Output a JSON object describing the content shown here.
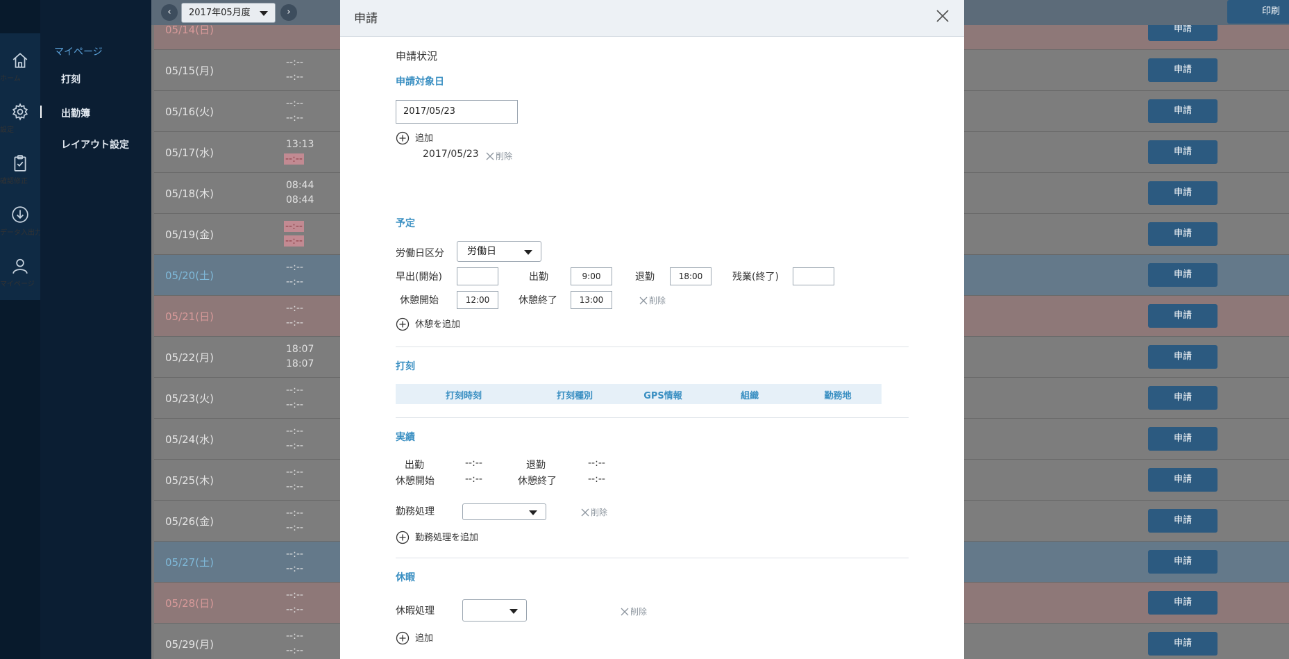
{
  "rail": [
    {
      "label": "ホーム",
      "icon": "home-icon"
    },
    {
      "label": "設定",
      "icon": "gear-icon"
    },
    {
      "label": "確認修正",
      "icon": "clipboard-check-icon"
    },
    {
      "label": "データ入出力",
      "icon": "download-icon"
    },
    {
      "label": "マイページ",
      "icon": "person-icon"
    }
  ],
  "menu": {
    "heading": "マイページ",
    "items": [
      "打刻",
      "出勤簿",
      "レイアウト設定"
    ]
  },
  "topbar": {
    "prev": "‹",
    "next": "›",
    "period": "2017年05月度",
    "print": "印刷"
  },
  "rows": [
    {
      "date": "05/14(日)",
      "t1": "--:--",
      "t2": "",
      "kind": "sun",
      "apply": "申請"
    },
    {
      "date": "05/15(月)",
      "t1": "--:--",
      "t2": "--:--",
      "kind": "",
      "apply": "申請"
    },
    {
      "date": "05/16(火)",
      "t1": "--:--",
      "t2": "--:--",
      "kind": "",
      "apply": "申請"
    },
    {
      "date": "05/17(水)",
      "t1": "13:13",
      "t2": "--:--",
      "kind": "",
      "apply": "申請"
    },
    {
      "date": "05/18(木)",
      "t1": "08:44",
      "t2": "08:44",
      "kind": "",
      "apply": "申請"
    },
    {
      "date": "05/19(金)",
      "t1": "--:--",
      "t2": "--:--",
      "kind": "",
      "apply": "申請"
    },
    {
      "date": "05/20(土)",
      "t1": "--:--",
      "t2": "--:--",
      "kind": "sat",
      "apply": "申請"
    },
    {
      "date": "05/21(日)",
      "t1": "--:--",
      "t2": "--:--",
      "kind": "sun",
      "apply": "申請"
    },
    {
      "date": "05/22(月)",
      "t1": "18:07",
      "t2": "18:07",
      "kind": "",
      "apply": "申請"
    },
    {
      "date": "05/23(火)",
      "t1": "--:--",
      "t2": "--:--",
      "kind": "",
      "apply": "申請"
    },
    {
      "date": "05/24(水)",
      "t1": "--:--",
      "t2": "--:--",
      "kind": "",
      "apply": "申請"
    },
    {
      "date": "05/25(木)",
      "t1": "--:--",
      "t2": "--:--",
      "kind": "",
      "apply": "申請"
    },
    {
      "date": "05/26(金)",
      "t1": "--:--",
      "t2": "--:--",
      "kind": "",
      "apply": "申請"
    },
    {
      "date": "05/27(土)",
      "t1": "--:--",
      "t2": "--:--",
      "kind": "sat",
      "apply": "申請"
    },
    {
      "date": "05/28(日)",
      "t1": "--:--",
      "t2": "--:--",
      "kind": "sun",
      "apply": "申請"
    },
    {
      "date": "05/29(月)",
      "t1": "--:--",
      "t2": "--:--",
      "kind": "",
      "apply": "申請"
    }
  ],
  "modal": {
    "title": "申請",
    "status_heading": "申請状況",
    "target": {
      "title": "申請対象日",
      "date_value": "2017/05/23",
      "add": "追加",
      "listed_date": "2017/05/23",
      "delete": "削除"
    },
    "plan": {
      "title": "予定",
      "workday_label": "労働日区分",
      "workday_value": "労働日",
      "early_label": "早出(開始)",
      "early_value": "",
      "start_label": "出勤",
      "start_value": "9:00",
      "end_label": "退勤",
      "end_value": "18:00",
      "overtime_label": "残業(終了)",
      "overtime_value": "",
      "break_start_label": "休憩開始",
      "break_start_value": "12:00",
      "break_end_label": "休憩終了",
      "break_end_value": "13:00",
      "delete": "削除",
      "add_break": "休憩を追加"
    },
    "stamp": {
      "title": "打刻",
      "columns": [
        "打刻時刻",
        "打刻種別",
        "GPS情報",
        "組織",
        "勤務地"
      ]
    },
    "actual": {
      "title": "実績",
      "start_label": "出勤",
      "start_value": "--:--",
      "end_label": "退勤",
      "end_value": "--:--",
      "break_start_label": "休憩開始",
      "break_start_value": "--:--",
      "break_end_label": "休憩終了",
      "break_end_value": "--:--",
      "work_proc_label": "勤務処理",
      "work_proc_value": "",
      "delete": "削除",
      "add_work_proc": "勤務処理を追加"
    },
    "leave": {
      "title": "休暇",
      "leave_proc_label": "休暇処理",
      "leave_proc_value": "",
      "delete": "削除",
      "add": "追加"
    }
  },
  "colors": {
    "accent": "#3a8fc2",
    "button": "#2c5a80",
    "rail": "#0f2a44"
  }
}
